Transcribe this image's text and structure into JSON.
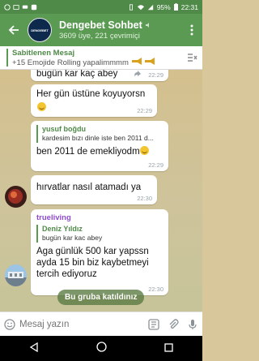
{
  "status_bar": {
    "battery": "95%",
    "time": "22:31"
  },
  "header": {
    "title": "Dengebet Sohbet",
    "subtitle": "3609 üye, 221 çevrimiçi",
    "avatar_text": "DENGEBET"
  },
  "pinned": {
    "title": "Sabitlenen Mesaj",
    "body": "+15 Emojide   Rolling yapalimmmm"
  },
  "messages": [
    {
      "text": "bugün kar kaç abey",
      "time": "22:29"
    },
    {
      "text": "Her gün üstüne koyuyorsn",
      "time": "22:29"
    },
    {
      "reply_name": "yusuf boğdu",
      "reply_text": "kardesim bızı dinle iste ben 2011 d...",
      "text": "ben 2011 de emekliyodm",
      "time": "22:29"
    },
    {
      "text": "hırvatlar nasıl atamadı ya",
      "time": "22:30"
    },
    {
      "sender": "trueliving",
      "reply_name": "Deniz Yıldız",
      "reply_text": "bugün kar kac abey",
      "text": "Aga günlük 500 kar yapssn ayda 15 bin biz kaybetmeyi tercih ediyoruz",
      "time": "22:30"
    }
  ],
  "joined_banner": "Bu gruba katıldınız",
  "input": {
    "placeholder": "Mesaj yazın"
  },
  "colors": {
    "header_green": "#5b9a53",
    "accent_green": "#4f8a48",
    "sender_purple": "#8f4bcf"
  }
}
